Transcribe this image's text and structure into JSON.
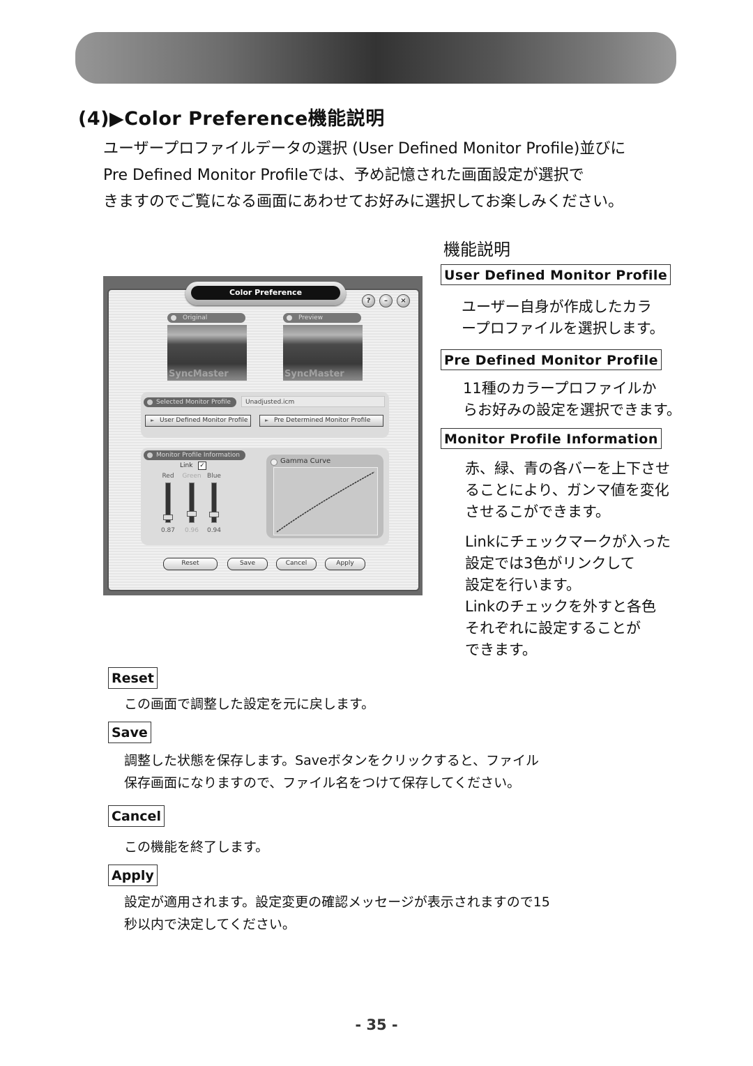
{
  "heading": "(4)▶Color Preference機能説明",
  "intro": [
    "ユーザープロファイルデータの選択 (User Defined Monitor Profile)並びに",
    "Pre Defined Monitor Profileでは、予め記憶された画面設定が選択で",
    "きますのでご覧になる画面にあわせてお好みに選択してお楽しみください。"
  ],
  "app": {
    "title": "Color Preference",
    "window_buttons": [
      {
        "icon": "help-icon",
        "glyph": "?"
      },
      {
        "icon": "minimize-icon",
        "glyph": "–"
      },
      {
        "icon": "close-icon",
        "glyph": "×"
      }
    ],
    "original_label": "Original",
    "preview_label": "Preview",
    "photo_watermark": "SyncMaster",
    "selected_profile_label": "Selected Monitor Profile",
    "selected_profile_value": "Unadjusted.icm",
    "user_defined_button": "User Defined Monitor Profile",
    "pre_determined_button": "Pre Determined Monitor Profile",
    "monitor_info_label": "Monitor Profile Information",
    "link_label": "Link",
    "link_checked": true,
    "sliders": [
      {
        "label": "Red",
        "value": "0.87",
        "level": 0.87
      },
      {
        "label": "Green",
        "value": "0.96",
        "level": 0.96
      },
      {
        "label": "Blue",
        "value": "0.94",
        "level": 0.94
      }
    ],
    "gamma_label": "Gamma Curve",
    "buttons": {
      "reset": "Reset",
      "save": "Save",
      "cancel": "Cancel",
      "apply": "Apply"
    }
  },
  "features": {
    "title": "機能説明",
    "user_defined": {
      "label": "User Defined Monitor Profile",
      "desc": [
        "ユーザー自身が作成したカラ",
        "ープロファイルを選択します。"
      ]
    },
    "pre_defined": {
      "label": "Pre Defined Monitor Profile",
      "desc": [
        "11種のカラープロファイルか",
        "らお好みの設定を選択できます。"
      ]
    },
    "monitor_info": {
      "label": "Monitor Profile Information",
      "desc": [
        "赤、緑、青の各バーを上下させ",
        "ることにより、ガンマ値を変化",
        "させるこができます。"
      ],
      "link_desc": [
        "Linkにチェックマークが入った",
        "設定では3色がリンクして",
        "設定を行います。",
        "Linkのチェックを外すと各色",
        "それぞれに設定することが",
        "できます。"
      ]
    }
  },
  "buttons_help": {
    "reset": {
      "label": "Reset",
      "desc": [
        "この画面で調整した設定を元に戻します。"
      ]
    },
    "save": {
      "label": "Save",
      "desc": [
        "調整した状態を保存します。Saveボタンをクリックすると、ファイル",
        "保存画面になりますので、ファイル名をつけて保存してください。"
      ]
    },
    "cancel": {
      "label": "Cancel",
      "desc": [
        "この機能を終了します。"
      ]
    },
    "apply": {
      "label": "Apply",
      "desc": [
        "設定が適用されます。設定変更の確認メッセージが表示されますので15",
        "秒以内で決定してください。"
      ]
    }
  },
  "page_number": "- 35 -"
}
